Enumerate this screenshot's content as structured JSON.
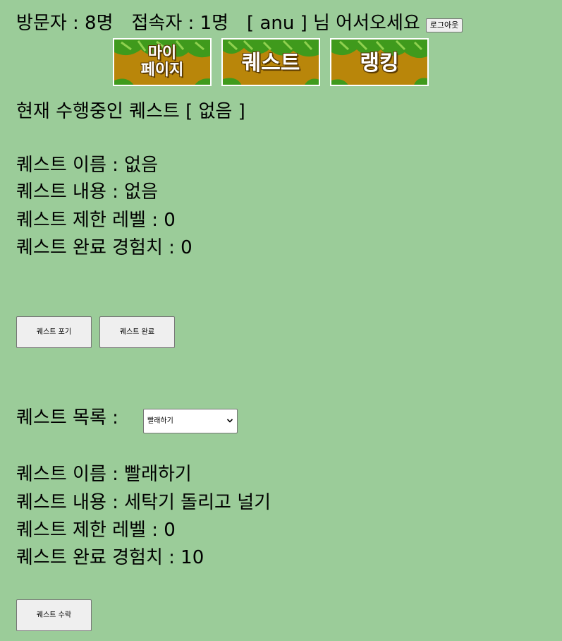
{
  "header": {
    "visitors": "방문자 : 8명",
    "connected": "접속자 : 1명",
    "welcome": "[ anu ] 님 어서오세요",
    "logout_label": "로그아웃"
  },
  "nav": {
    "mypage_line1": "마이",
    "mypage_line2": "페이지",
    "quest_label": "퀘스트",
    "ranking_label": "랭킹"
  },
  "current_quest": {
    "status": "현재 수행중인 퀘스트 [ 없음 ]",
    "name": "퀘스트 이름 : 없음",
    "content": "퀘스트 내용 : 없음",
    "level": "퀘스트 제한 레벨 : 0",
    "exp": "퀘스트 완료 경험치 : 0",
    "give_up_label": "퀘스트 포기",
    "complete_label": "퀘스트 완료"
  },
  "quest_list": {
    "label": "퀘스트 목록 :",
    "selected": "빨래하기",
    "name": "퀘스트 이름 : 빨래하기",
    "content": "퀘스트 내용 : 세탁기 돌리고 널기",
    "level": "퀘스트 제한 레벨 : 0",
    "exp": "퀘스트 완료 경험치 : 10",
    "accept_label": "퀘스트 수락"
  },
  "colors": {
    "background": "#9bcc99",
    "nav_button_bg": "#b9860a",
    "leaf_green": "#3f9a1c"
  }
}
